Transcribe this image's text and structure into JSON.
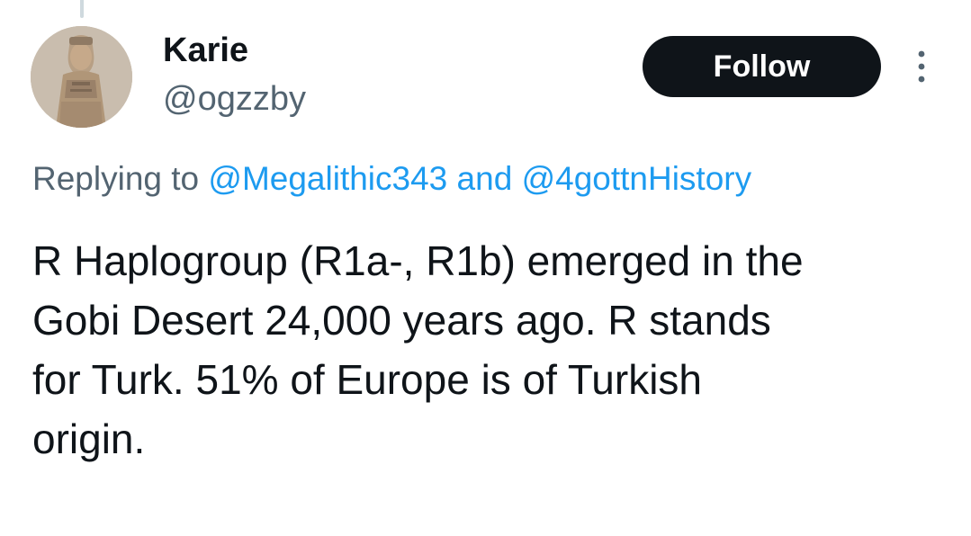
{
  "author": {
    "display_name": "Karie",
    "handle": "@ogzzby",
    "avatar_icon": "avatar-statue-photo"
  },
  "actions": {
    "follow_label": "Follow",
    "more_icon": "more-vertical-icon"
  },
  "reply": {
    "prefix": "Replying to",
    "mention_1": "@Megalithic343",
    "joiner": "and",
    "mention_2": "@4gottnHistory"
  },
  "tweet": {
    "text": "R Haplogroup (R1a-, R1b) emerged in the\nGobi Desert 24,000 years ago.  R stands\nfor Turk.  51% of Europe is of Turkish\norigin."
  },
  "colors": {
    "text_primary": "#0f1419",
    "text_secondary": "#536471",
    "link": "#1d9bf0",
    "follow_bg": "#0f1419",
    "thread_line": "#cfd9de"
  }
}
